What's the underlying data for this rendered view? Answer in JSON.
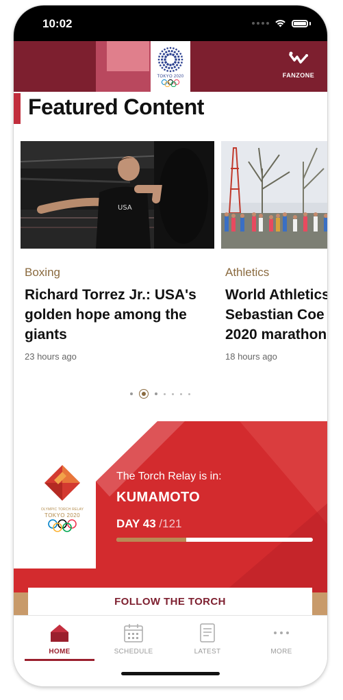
{
  "status_bar": {
    "time": "10:02"
  },
  "header": {
    "logo_text": "TOKYO 2020",
    "fanzone_label": "FANZONE"
  },
  "featured": {
    "title": "Featured Content",
    "cards": [
      {
        "category": "Boxing",
        "title_lines": [
          "Richard Torrez Jr.: USA's",
          "golden hope among the",
          "giants"
        ],
        "time": "23 hours ago"
      },
      {
        "category": "Athletics",
        "title_lines": [
          "World Athletics",
          "Sebastian Coe",
          "2020 marathon"
        ],
        "time": "18 hours ago"
      }
    ],
    "pager": {
      "count": 7,
      "active_index": 1
    }
  },
  "torch": {
    "logo_small": "OLYMPIC TORCH RELAY",
    "logo_tokyo": "TOKYO 2020",
    "relay_in_label": "The Torch Relay is in:",
    "city": "KUMAMOTO",
    "day_label": "DAY 43",
    "day_total": "/121",
    "progress": 0.355,
    "follow_button": "FOLLOW THE TORCH",
    "colors": {
      "red": "#d32b2e",
      "dark_red": "#7d1f2f",
      "gold": "#b98a55"
    }
  },
  "tabbar": {
    "tabs": [
      {
        "label": "HOME",
        "icon": "house-icon",
        "active": true
      },
      {
        "label": "SCHEDULE",
        "icon": "calendar-icon",
        "active": false
      },
      {
        "label": "LATEST",
        "icon": "document-icon",
        "active": false
      },
      {
        "label": "MORE",
        "icon": "more-dots-icon",
        "active": false
      }
    ]
  }
}
